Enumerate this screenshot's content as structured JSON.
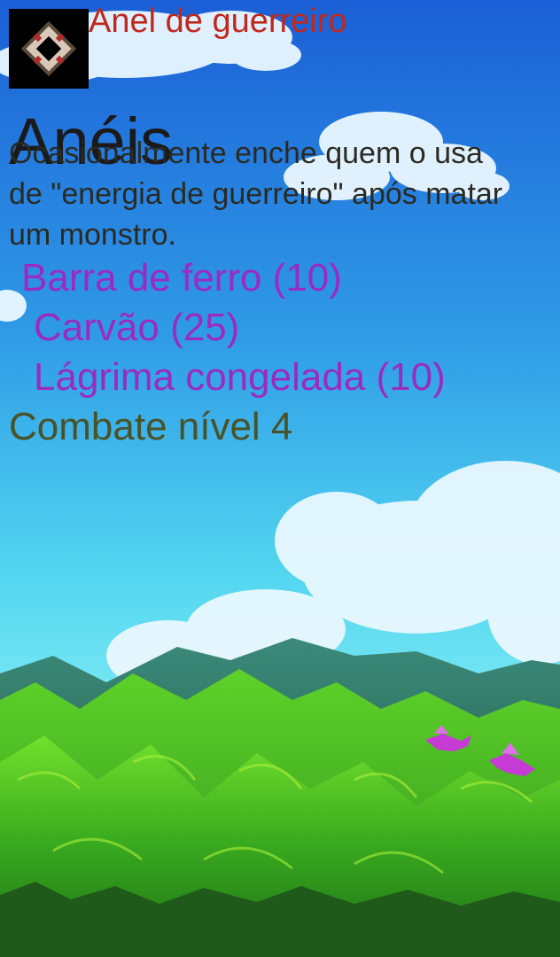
{
  "item": {
    "name": "Anel de guerreiro",
    "category": "Anéis",
    "description": "Ocasionalmente enche quem o usa de \"energia de guerreiro\" após matar um monstro.",
    "icon": "ring-icon"
  },
  "recipe": {
    "ingredients": [
      "Barra de ferro (10)",
      "Carvão (25)",
      "Lágrima congelada (10)"
    ],
    "requirement": "Combate nível 4"
  },
  "colors": {
    "name": "#c0281c",
    "ingredient": "#9b2bc0",
    "requirement": "#4a5228",
    "sky_top": "#1f64d8",
    "sky_bottom": "#5fe4f4",
    "hills": "#3fae24"
  },
  "scene": {
    "background": "sky-mountains-landscape",
    "creatures": [
      "bird-icon",
      "bird-icon"
    ]
  }
}
